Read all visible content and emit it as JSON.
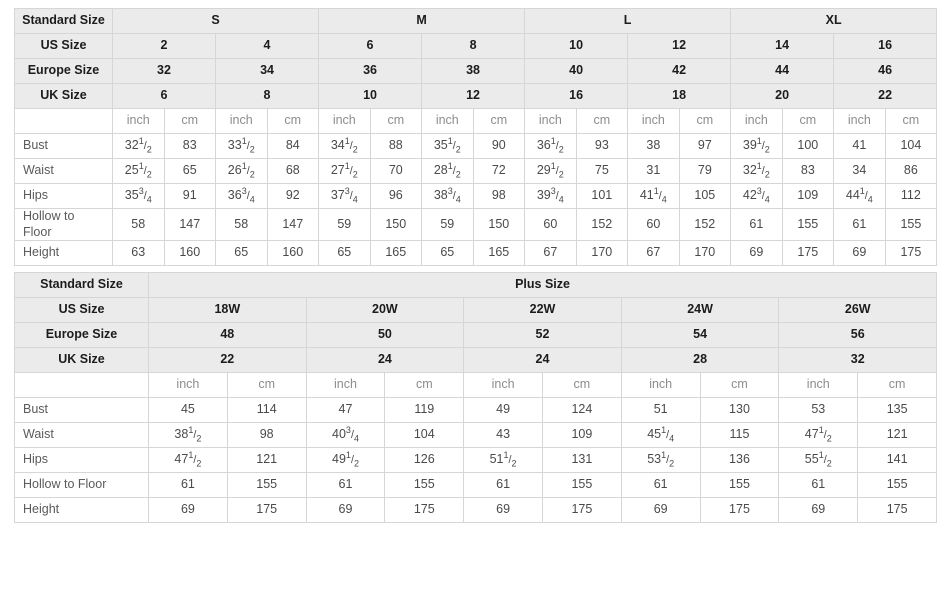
{
  "labels": {
    "standard_size": "Standard Size",
    "us_size": "US Size",
    "europe_size": "Europe Size",
    "uk_size": "UK Size",
    "inch": "inch",
    "cm": "cm",
    "bust": "Bust",
    "waist": "Waist",
    "hips": "Hips",
    "hollow_to_floor": "Hollow to Floor",
    "hollow_to_floor_wrapped": "Hollow to\nFloor",
    "height": "Height",
    "plus_size": "Plus Size"
  },
  "colors": {
    "header_bg": "#ebebeb",
    "cell_bg": "#ffffff",
    "border": "#d6d6d6",
    "header_text": "#1c1c1c",
    "body_text": "#4a4a4a",
    "unit_text": "#8d8d8d"
  },
  "standard_table": {
    "size_groups": [
      "S",
      "M",
      "L",
      "XL"
    ],
    "us_sizes": [
      "2",
      "4",
      "6",
      "8",
      "10",
      "12",
      "14",
      "16"
    ],
    "europe_sizes": [
      "32",
      "34",
      "36",
      "38",
      "40",
      "42",
      "44",
      "46"
    ],
    "uk_sizes": [
      "6",
      "8",
      "10",
      "12",
      "16",
      "18",
      "20",
      "22"
    ],
    "units": [
      "inch",
      "cm",
      "inch",
      "cm",
      "inch",
      "cm",
      "inch",
      "cm",
      "inch",
      "cm",
      "inch",
      "cm",
      "inch",
      "cm",
      "inch",
      "cm"
    ],
    "rows": [
      {
        "label": "Bust",
        "values": [
          {
            "whole": "32",
            "num": "1",
            "den": "2"
          },
          "83",
          {
            "whole": "33",
            "num": "1",
            "den": "2"
          },
          "84",
          {
            "whole": "34",
            "num": "1",
            "den": "2"
          },
          "88",
          {
            "whole": "35",
            "num": "1",
            "den": "2"
          },
          "90",
          {
            "whole": "36",
            "num": "1",
            "den": "2"
          },
          "93",
          "38",
          "97",
          {
            "whole": "39",
            "num": "1",
            "den": "2"
          },
          "100",
          "41",
          "104"
        ]
      },
      {
        "label": "Waist",
        "values": [
          {
            "whole": "25",
            "num": "1",
            "den": "2"
          },
          "65",
          {
            "whole": "26",
            "num": "1",
            "den": "2"
          },
          "68",
          {
            "whole": "27",
            "num": "1",
            "den": "2"
          },
          "70",
          {
            "whole": "28",
            "num": "1",
            "den": "2"
          },
          "72",
          {
            "whole": "29",
            "num": "1",
            "den": "2"
          },
          "75",
          "31",
          "79",
          {
            "whole": "32",
            "num": "1",
            "den": "2"
          },
          "83",
          "34",
          "86"
        ]
      },
      {
        "label": "Hips",
        "values": [
          {
            "whole": "35",
            "num": "3",
            "den": "4"
          },
          "91",
          {
            "whole": "36",
            "num": "3",
            "den": "4"
          },
          "92",
          {
            "whole": "37",
            "num": "3",
            "den": "4"
          },
          "96",
          {
            "whole": "38",
            "num": "3",
            "den": "4"
          },
          "98",
          {
            "whole": "39",
            "num": "3",
            "den": "4"
          },
          "101",
          {
            "whole": "41",
            "num": "1",
            "den": "4"
          },
          "105",
          {
            "whole": "42",
            "num": "3",
            "den": "4"
          },
          "109",
          {
            "whole": "44",
            "num": "1",
            "den": "4"
          },
          "112"
        ]
      },
      {
        "label": "Hollow to Floor",
        "wrapped": true,
        "values": [
          "58",
          "147",
          "58",
          "147",
          "59",
          "150",
          "59",
          "150",
          "60",
          "152",
          "60",
          "152",
          "61",
          "155",
          "61",
          "155"
        ]
      },
      {
        "label": "Height",
        "values": [
          "63",
          "160",
          "65",
          "160",
          "65",
          "165",
          "65",
          "165",
          "67",
          "170",
          "67",
          "170",
          "69",
          "175",
          "69",
          "175"
        ]
      }
    ]
  },
  "plus_table": {
    "group_label": "Plus Size",
    "us_sizes": [
      "18W",
      "20W",
      "22W",
      "24W",
      "26W"
    ],
    "europe_sizes": [
      "48",
      "50",
      "52",
      "54",
      "56"
    ],
    "uk_sizes": [
      "22",
      "24",
      "24",
      "28",
      "32"
    ],
    "units": [
      "inch",
      "cm",
      "inch",
      "cm",
      "inch",
      "cm",
      "inch",
      "cm",
      "inch",
      "cm"
    ],
    "rows": [
      {
        "label": "Bust",
        "values": [
          "45",
          "114",
          "47",
          "119",
          "49",
          "124",
          "51",
          "130",
          "53",
          "135"
        ]
      },
      {
        "label": "Waist",
        "values": [
          {
            "whole": "38",
            "num": "1",
            "den": "2"
          },
          "98",
          {
            "whole": "40",
            "num": "3",
            "den": "4"
          },
          "104",
          "43",
          "109",
          {
            "whole": "45",
            "num": "1",
            "den": "4"
          },
          "115",
          {
            "whole": "47",
            "num": "1",
            "den": "2"
          },
          "121"
        ]
      },
      {
        "label": "Hips",
        "values": [
          {
            "whole": "47",
            "num": "1",
            "den": "2"
          },
          "121",
          {
            "whole": "49",
            "num": "1",
            "den": "2"
          },
          "126",
          {
            "whole": "51",
            "num": "1",
            "den": "2"
          },
          "131",
          {
            "whole": "53",
            "num": "1",
            "den": "2"
          },
          "136",
          {
            "whole": "55",
            "num": "1",
            "den": "2"
          },
          "141"
        ]
      },
      {
        "label": "Hollow to Floor",
        "values": [
          "61",
          "155",
          "61",
          "155",
          "61",
          "155",
          "61",
          "155",
          "61",
          "155"
        ]
      },
      {
        "label": "Height",
        "values": [
          "69",
          "175",
          "69",
          "175",
          "69",
          "175",
          "69",
          "175",
          "69",
          "175"
        ]
      }
    ]
  }
}
